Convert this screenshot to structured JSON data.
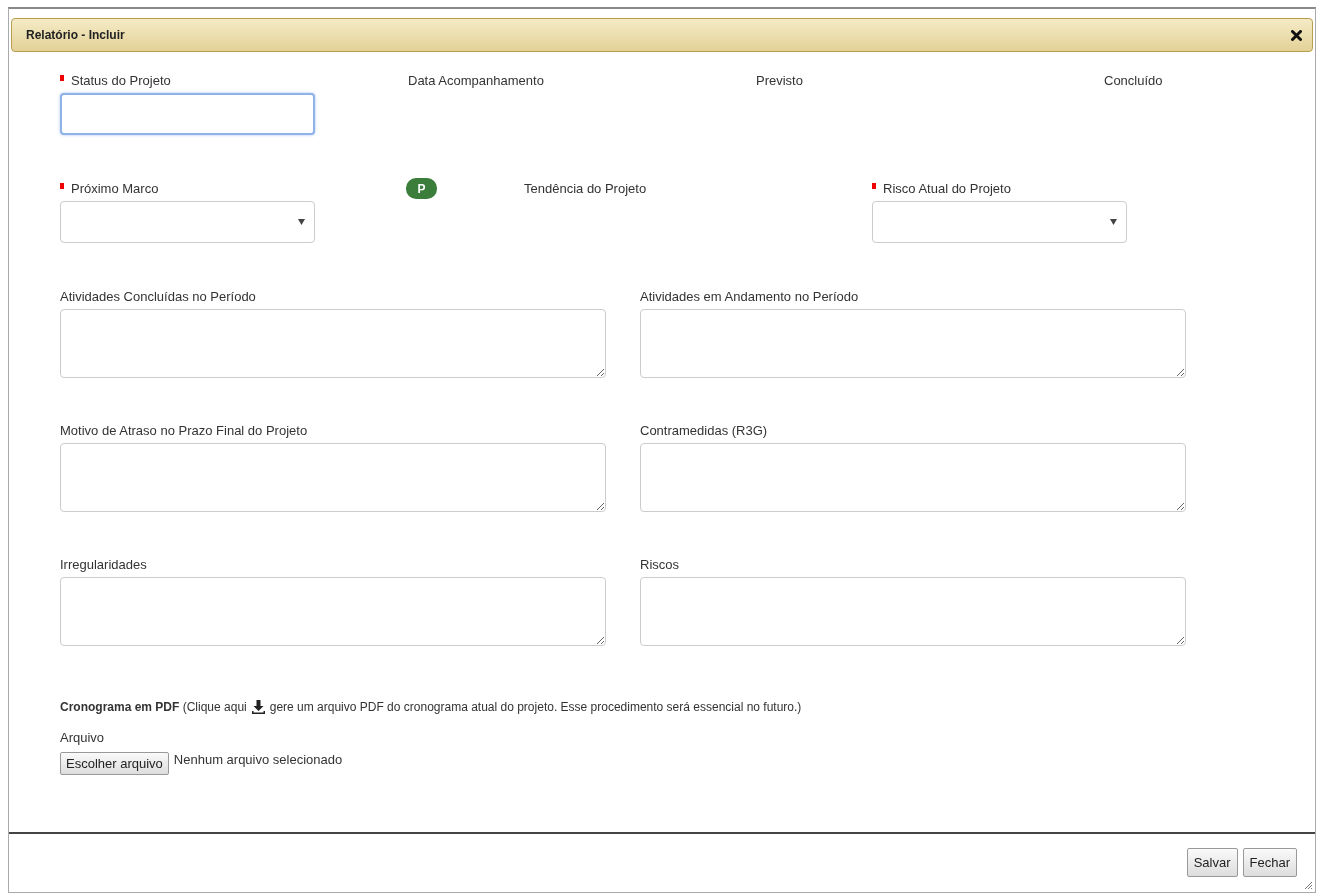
{
  "window": {
    "title": "Relatório - Incluir"
  },
  "top_row": [
    {
      "label": "Status do Projeto",
      "required": true,
      "kind": "text",
      "focused": true
    },
    {
      "label": "Data Acompanhamento",
      "required": false,
      "kind": "label"
    },
    {
      "label": "Previsto",
      "required": false,
      "kind": "label"
    },
    {
      "label": "Concluído",
      "required": false,
      "kind": "label"
    }
  ],
  "second_row": [
    {
      "label": "Próximo Marco",
      "required": true,
      "kind": "select"
    },
    {
      "label": "Tendência do Projeto",
      "required": false,
      "kind": "badge",
      "badge": "P"
    },
    {
      "label": "Risco Atual do Projeto",
      "required": true,
      "kind": "select"
    }
  ],
  "text_areas": [
    {
      "label": "Atividades Concluídas no Período"
    },
    {
      "label": "Atividades em Andamento no Período"
    },
    {
      "label": "Motivo de Atraso no Prazo Final do Projeto"
    },
    {
      "label": "Contramedidas (R3G)"
    },
    {
      "label": "Irregularidades"
    },
    {
      "label": "Riscos"
    }
  ],
  "pdf_note": {
    "before": "**Cronograma em PDF** (Clique aqui",
    "after": "gere um arquivo PDF do cronograma atual do projeto. Esse procedimento será essencial no futuro.)"
  },
  "file": {
    "label": "Arquivo",
    "button": "Escolher arquivo",
    "status": "Nenhum arquivo selecionado"
  },
  "buttons": [
    "Salvar",
    "Fechar"
  ]
}
